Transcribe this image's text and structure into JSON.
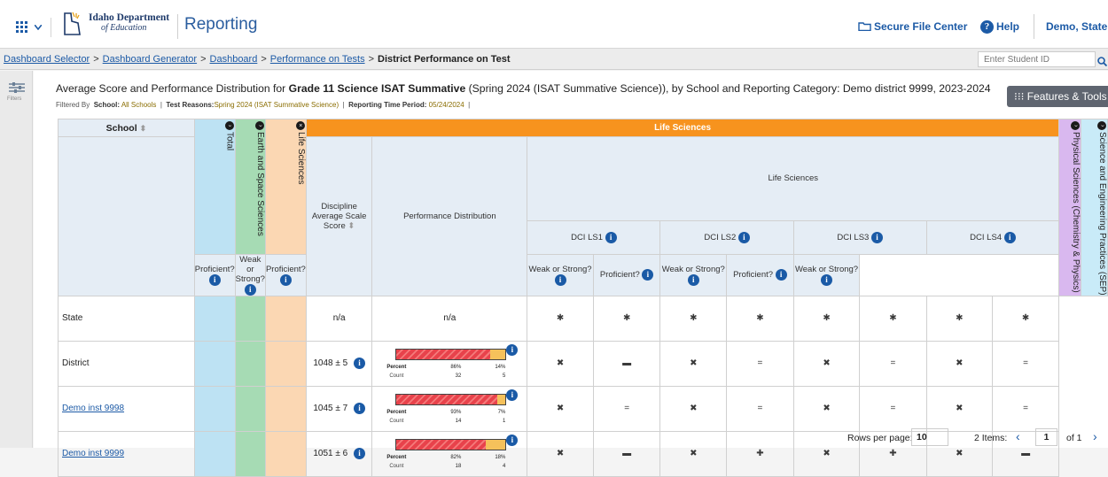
{
  "topbar": {
    "logo_line1": "Idaho Department",
    "logo_line2": "of Education",
    "app_title": "Reporting",
    "secure_file": "Secure File Center",
    "help": "Help",
    "user": "Demo, State"
  },
  "breadcrumb": {
    "items": [
      "Dashboard Selector",
      "Dashboard Generator",
      "Dashboard",
      "Performance on Tests"
    ],
    "current": "District Performance on Test",
    "separator": ">"
  },
  "student_search": {
    "placeholder": "Enter Student ID"
  },
  "filters_label": "Filters",
  "report": {
    "headline_pre": "Average Score and Performance Distribution for ",
    "headline_bold": "Grade 11 Science ISAT Summative",
    "headline_post": " (Spring 2024 (ISAT Summative Science)), by School and Reporting Category: Demo district 9999, 2023-2024",
    "filtered_by": "Filtered By",
    "school_label": "School:",
    "school_value": "All Schools",
    "test_label": "Test Reasons:",
    "test_value": "Spring 2024 (ISAT Summative Science)",
    "period_label": "Reporting Time Period:",
    "period_value": "05/24/2024",
    "features_button": "Features & Tools"
  },
  "table": {
    "school_header": "School",
    "total": "Total",
    "earth": "Earth and Space Sciences",
    "life_vertical": "Life Sciences",
    "life_group": "Life Sciences",
    "life_sub": "Life Sciences",
    "disc_avg": "Discipline Average Scale Score",
    "perf_dist": "Performance Distribution",
    "dci": [
      "DCI LS1",
      "DCI LS2",
      "DCI LS3",
      "DCI LS4"
    ],
    "proficient": "Proficient?",
    "weak_strong": "Weak or Strong?",
    "physical": "Physical Sciences (Chemistry & Physics)",
    "sep": "Science and Engineering Practices (SEP)",
    "percent_label": "Percent",
    "count_label": "Count",
    "rows": [
      {
        "name": "State",
        "link": false,
        "score": "n/a",
        "pd_text": "n/a",
        "marks": [
          "*",
          "*",
          "*",
          "*",
          "*",
          "*",
          "*",
          "*"
        ]
      },
      {
        "name": "District",
        "link": false,
        "score": "1048 ± 5",
        "pct": [
          "86%",
          "14%"
        ],
        "cnt": [
          "32",
          "5"
        ],
        "marks": [
          "x",
          "-",
          "x",
          "=",
          "x",
          "=",
          "x",
          "="
        ]
      },
      {
        "name": "Demo inst 9998",
        "link": true,
        "score": "1045 ± 7",
        "pct": [
          "93%",
          "7%"
        ],
        "cnt": [
          "14",
          "1"
        ],
        "marks": [
          "x",
          "=",
          "x",
          "=",
          "x",
          "=",
          "x",
          "="
        ]
      },
      {
        "name": "Demo inst 9999",
        "link": true,
        "score": "1051 ± 6",
        "pct": [
          "82%",
          "18%"
        ],
        "cnt": [
          "18",
          "4"
        ],
        "marks": [
          "x",
          "-",
          "x",
          "+",
          "x",
          "+",
          "x",
          "-"
        ]
      }
    ]
  },
  "pager": {
    "rows_label": "Rows per page:",
    "rows_value": "10",
    "items": "2 Items:",
    "page": "1",
    "of": "of 1"
  },
  "colors": {
    "life_sciences": "#f7931e",
    "total": "#bde2f3",
    "earth": "#a6dbb4",
    "life_col": "#fbd7b3",
    "physical": "#d9b8ef",
    "sep": "#c9ebf8",
    "link": "#1c5aa6"
  }
}
